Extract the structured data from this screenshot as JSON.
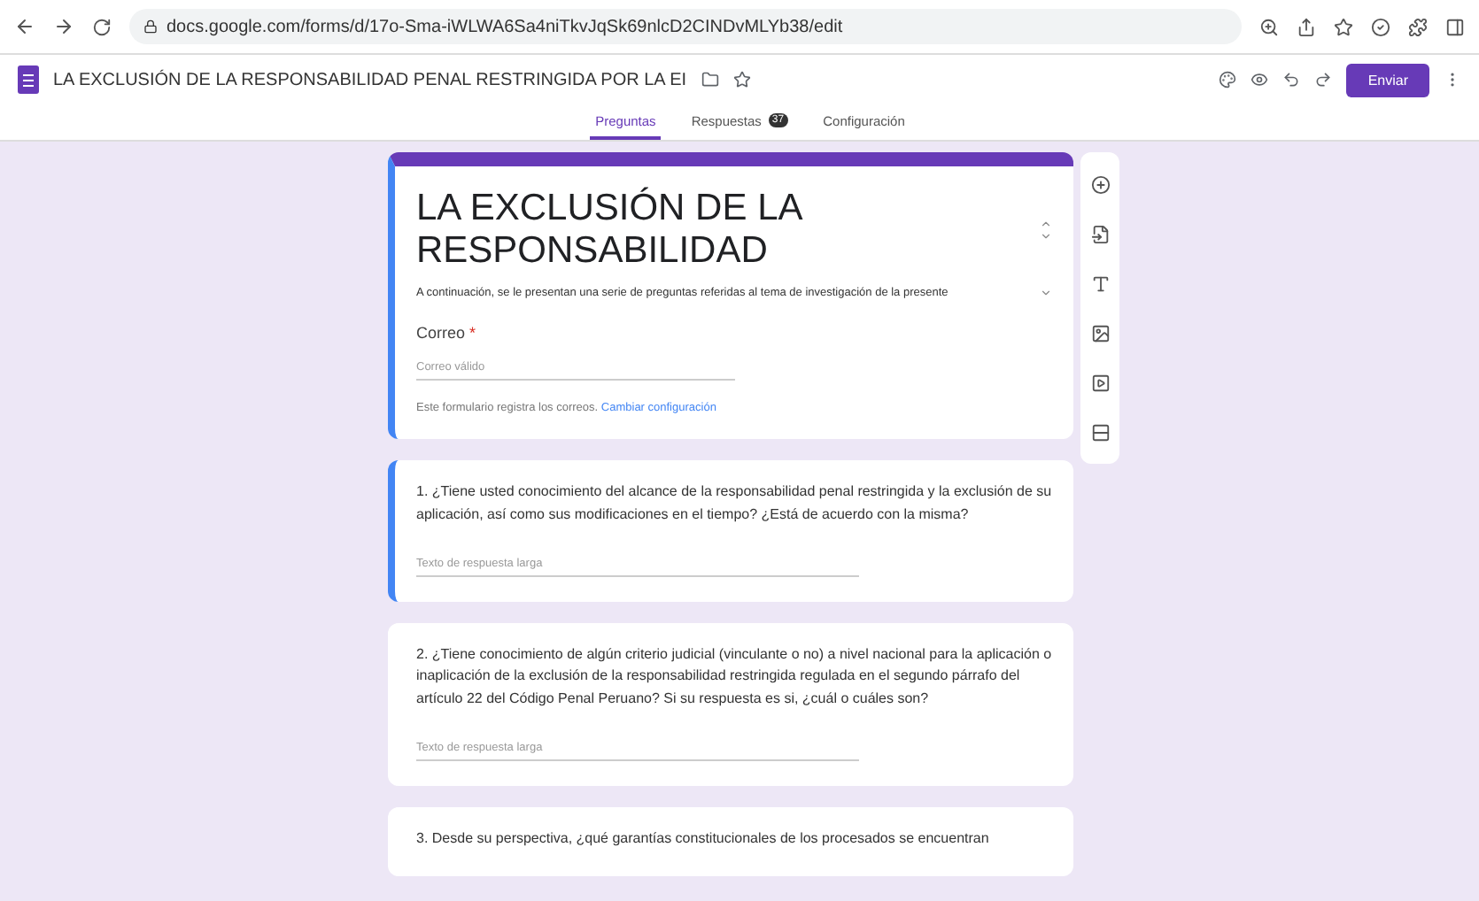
{
  "browser": {
    "url": "docs.google.com/forms/d/17o-Sma-iWLWA6Sa4niTkvJqSk69nlcD2CINDvMLYb38/edit"
  },
  "app": {
    "title": "LA EXCLUSIÓN DE LA RESPONSABILIDAD PENAL RESTRINGIDA POR LA EI",
    "send": "Enviar"
  },
  "tabs": [
    {
      "label": "Preguntas",
      "selected": true
    },
    {
      "label": "Respuestas",
      "selected": false,
      "badge": "37"
    },
    {
      "label": "Configuración",
      "selected": false
    }
  ],
  "form": {
    "title": "LA EXCLUSIÓN DE LA RESPONSABILIDAD",
    "description": "A continuación, se le presentan una serie de preguntas referidas al tema de investigación de la presente",
    "selected": true,
    "email": {
      "label": "Correo",
      "required_mark": "*",
      "placeholder": "Correo válido"
    },
    "note": "Este formulario registra los correos.",
    "note_link": "Cambiar configuración"
  },
  "questions": [
    {
      "text": "1.   ¿Tiene usted conocimiento del alcance de la responsabilidad penal restringida y la exclusión de su aplicación, así como sus modificaciones en el tiempo? ¿Está de acuerdo con la misma?",
      "placeholder": "Texto de respuesta larga",
      "selected": true
    },
    {
      "text": "2.   ¿Tiene conocimiento de algún criterio judicial (vinculante o no) a nivel nacional para la aplicación o inaplicación de la exclusión de la responsabilidad restringida regulada en el segundo párrafo del artículo 22 del Código Penal Peruano? Si su respuesta es si, ¿cuál o cuáles son?",
      "placeholder": "Texto de respuesta larga",
      "selected": false
    },
    {
      "text": "3.   Desde su perspectiva, ¿qué garantías constitucionales de los procesados se encuentran",
      "selected": false
    }
  ]
}
